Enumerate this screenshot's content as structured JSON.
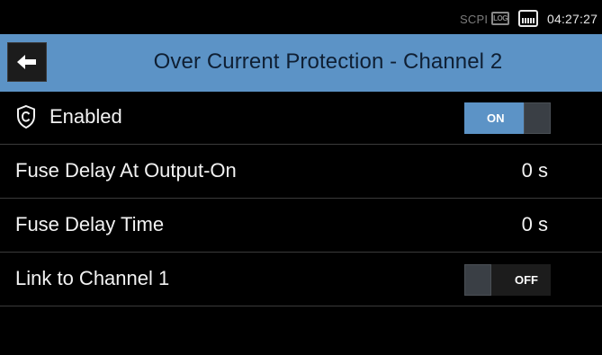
{
  "status_bar": {
    "scpi_label": "SCPI",
    "log_label": "LOG",
    "lan_icon": "lan-connector-icon",
    "time": "04:27:27"
  },
  "header": {
    "back_icon": "arrow-left-icon",
    "title": "Over Current Protection - Channel 2"
  },
  "settings": [
    {
      "icon": "shield-icon",
      "label": "Enabled",
      "control": "toggle",
      "toggle_text": "ON",
      "state": true
    },
    {
      "label": "Fuse Delay At Output-On",
      "value": "0 s"
    },
    {
      "label": "Fuse Delay Time",
      "value": "0 s"
    },
    {
      "label": "Link to Channel 1",
      "control": "toggle",
      "toggle_text": "OFF",
      "state": false
    }
  ],
  "colors": {
    "accent": "#5c93c6",
    "background": "#000000",
    "divider": "#3b3b3b",
    "title_text": "#0f1f33"
  }
}
